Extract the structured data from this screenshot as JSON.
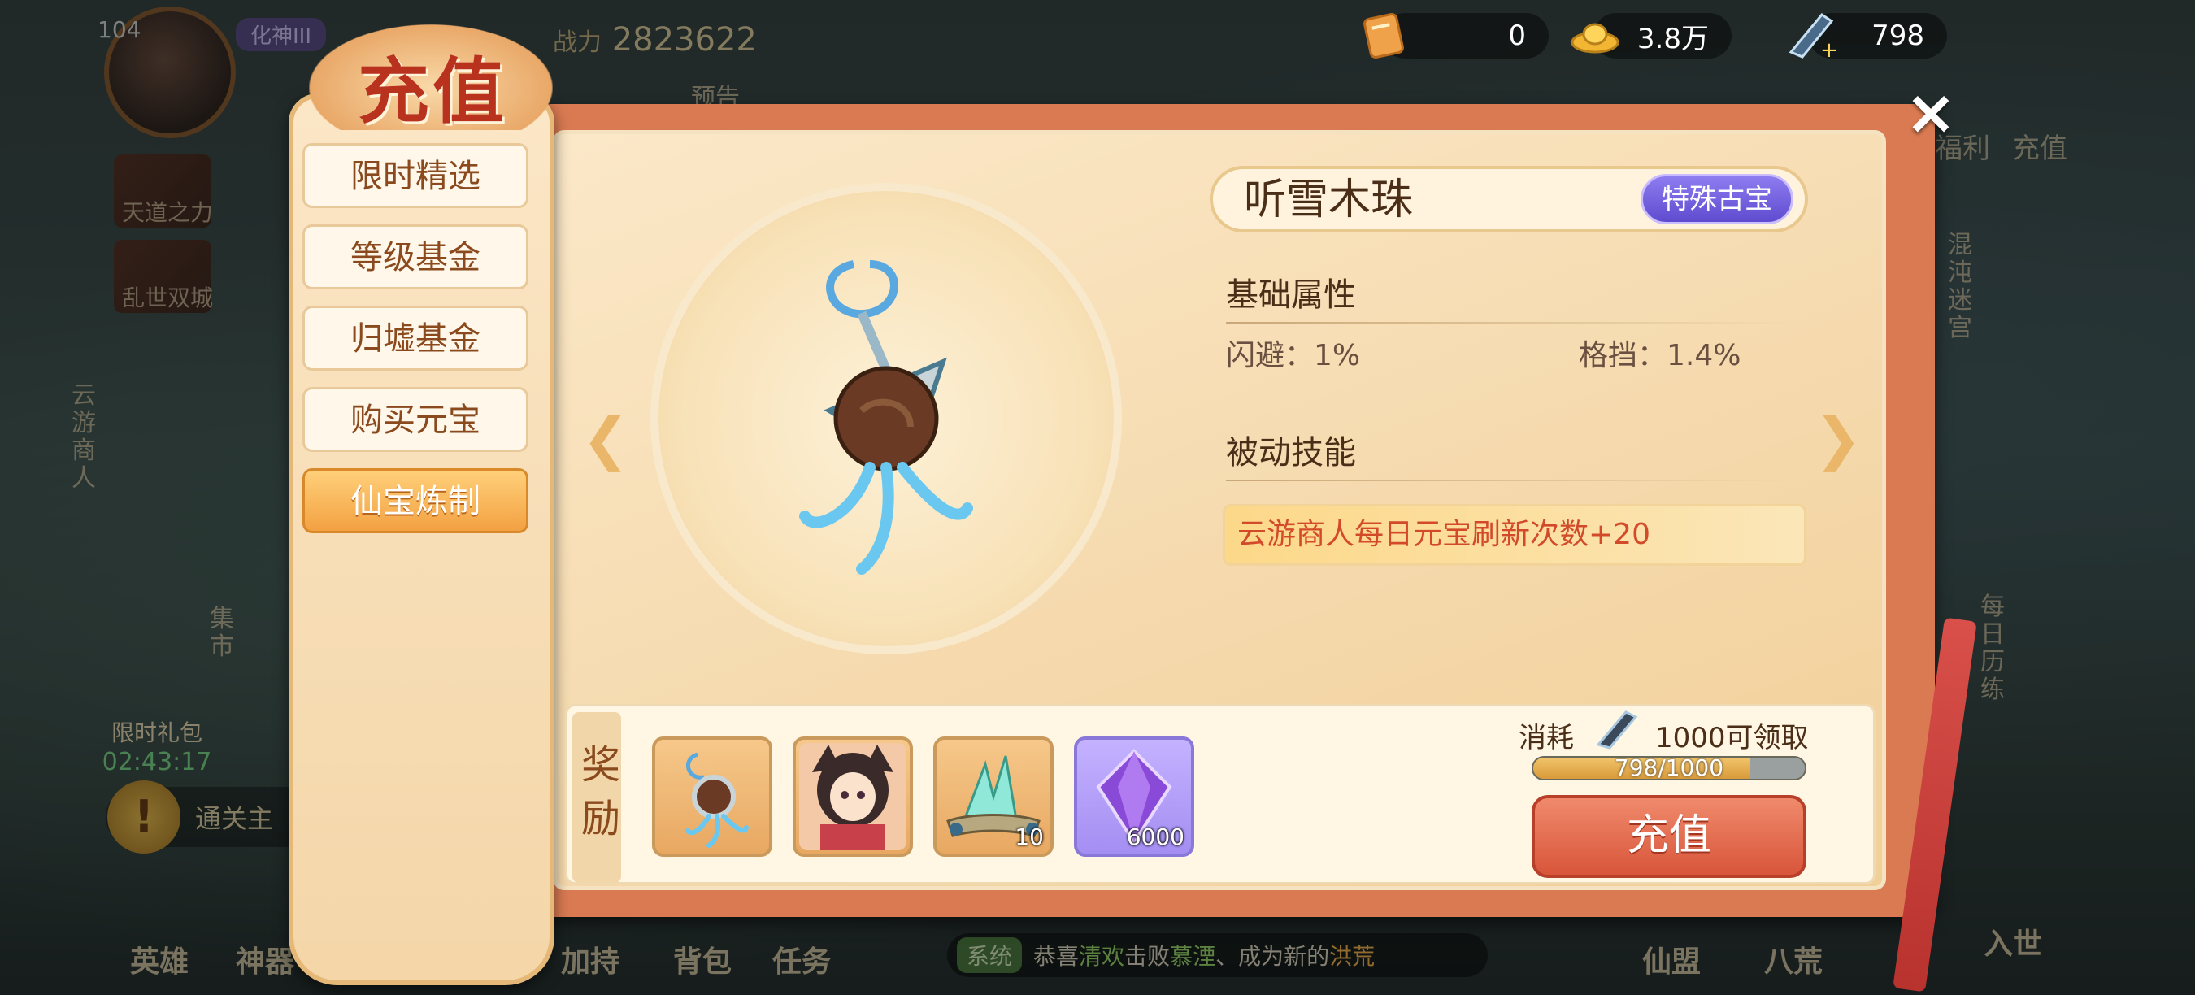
{
  "hud": {
    "level": "104",
    "title_badge": "化神III",
    "power_label": "战力",
    "power_value": "2823622",
    "currencies": [
      {
        "icon": "scroll-icon",
        "value": "0"
      },
      {
        "icon": "gold-ingot-icon",
        "value": "3.8万"
      },
      {
        "icon": "jade-shard-icon",
        "value": "798"
      }
    ],
    "bg_labels": [
      "天道之力",
      "乱世双城",
      "云游商人",
      "集市",
      "混沌迷宫",
      "每日历练",
      "福利",
      "充值",
      "预告"
    ],
    "timer_label": "限时礼包",
    "timer_value": "02:43:17",
    "alert_text": "通关主",
    "bottom_nav": [
      "英雄",
      "神器",
      "加持",
      "背包",
      "任务",
      "仙盟",
      "八荒",
      "入世"
    ],
    "ticker": {
      "tag": "系统",
      "pre": "恭喜",
      "name1": "清欢",
      "mid": "击败",
      "name2": "慕湮",
      "post": "、成为新的",
      "name3": "洪荒"
    }
  },
  "dialog": {
    "title": "充值",
    "menu": [
      {
        "label": "限时精选",
        "active": false
      },
      {
        "label": "等级基金",
        "active": false
      },
      {
        "label": "归墟基金",
        "active": false
      },
      {
        "label": "购买元宝",
        "active": false
      },
      {
        "label": "仙宝炼制",
        "active": true
      }
    ],
    "item": {
      "name": "听雪木珠",
      "rarity": "特殊古宝",
      "base_attr_title": "基础属性",
      "attrs": [
        {
          "label": "闪避：1%"
        },
        {
          "label": "格挡：1.4%"
        }
      ],
      "passive_title": "被动技能",
      "passive_text": "云游商人每日元宝刷新次数+20"
    },
    "rewards": {
      "label": "奖励",
      "slots": [
        {
          "icon": "pendant-icon",
          "qty": "",
          "tier": "gold"
        },
        {
          "icon": "hero-portrait-icon",
          "qty": "",
          "tier": "gold"
        },
        {
          "icon": "crystal-ore-icon",
          "qty": "10",
          "tier": "gold"
        },
        {
          "icon": "purple-gem-icon",
          "qty": "6000",
          "tier": "purple"
        }
      ]
    },
    "cost": {
      "label": "消耗",
      "amount_text": "1000可领取",
      "progress_text": "798/1000",
      "progress_fraction": 0.798,
      "button": "充值"
    }
  },
  "colors": {
    "accent_red": "#d8553a",
    "rarity_purple": "#5f4bcf",
    "skill_text": "#d34a2a"
  }
}
